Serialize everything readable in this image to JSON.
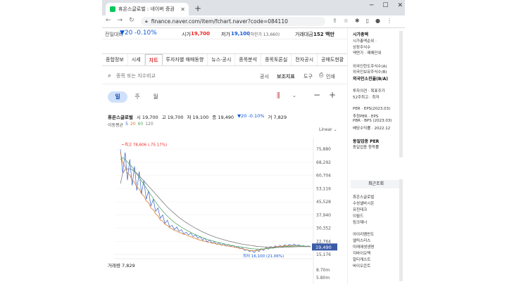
{
  "browser": {
    "tab_title": "휴온스글로벌 : 네이버 증권",
    "new_tab": "+",
    "url": "finance.naver.com/item/fchart.naver?code=084110"
  },
  "stock_strip": {
    "vs_label": "전일대비",
    "vs_value": "▼20",
    "vs_pct": "-0.10%",
    "open_label": "시가",
    "open_value": "19,700",
    "low_label": "저가",
    "low_value": "19,100",
    "low_limit": "(하한가 13,660)",
    "amount_label": "거래대금",
    "amount_value": "152 백만"
  },
  "main_tabs": [
    "종합정보",
    "시세",
    "차트",
    "투자자별 매매동향",
    "뉴스·공시",
    "종목분석",
    "종목토론실",
    "전자공시",
    "공매도현황"
  ],
  "search": {
    "placeholder": "종목 또는 지수비교",
    "buttons": [
      "공시",
      "보조지표",
      "도구",
      "인쇄"
    ]
  },
  "periods": [
    "일",
    "주",
    "월"
  ],
  "chart_header": {
    "name": "휴온스글로벌",
    "open": "시 19,700",
    "high": "고 19,700",
    "low": "저 19,100",
    "close": "종 19,490",
    "change": "▼20 -0.10%",
    "volume": "거 7,829",
    "ma_label": "이동평균",
    "ma_values": [
      "5",
      "20",
      "60",
      "120"
    ],
    "scale": "Linear"
  },
  "chart_annotations": {
    "max_label": "최고 78,606 (-75.17%)",
    "min_label": "최저 16,100 (21.06%)",
    "current_price": "19,490",
    "volume_label": "거래량 7,829",
    "volume_ticks": [
      "8.70m",
      "5.80m"
    ]
  },
  "chart_data": {
    "type": "line",
    "y_ticks": [
      "75,880",
      "68,292",
      "60,704",
      "53,116",
      "45,528",
      "37,940",
      "30,352",
      "22,764",
      "15,176"
    ],
    "ylim": [
      15176,
      80000
    ],
    "series": [
      {
        "values": [
          75800,
          62000,
          74000,
          58000,
          70000,
          55000,
          66000,
          52000,
          63000,
          50000,
          58000,
          47000,
          52000,
          43000,
          47000,
          40000,
          42000,
          36000,
          38000,
          33000,
          35000,
          31000,
          32000,
          29500,
          31000,
          28500,
          29500,
          27000,
          28000,
          26500,
          27500,
          25500,
          26500,
          24500,
          25500,
          23500,
          24500,
          22500,
          23500,
          21800,
          22500,
          21000,
          22000,
          20500,
          21500,
          20000,
          21000,
          19800,
          20500,
          19200,
          19800,
          18500,
          19000,
          17500,
          18000,
          16800,
          17500,
          16200,
          17800,
          16800,
          18500,
          17500,
          19200,
          18200,
          19800,
          18800,
          20200,
          19200,
          20500,
          19500,
          20800,
          19800,
          21000,
          20200,
          21200,
          20300,
          20800,
          19900,
          20300,
          19600,
          20100,
          19490
        ]
      },
      {
        "values": [
          74000,
          68000,
          66000,
          62000,
          61000,
          58000,
          57000,
          54000,
          53000,
          50000,
          49000,
          46000,
          45000,
          42000,
          41000,
          38500,
          37500,
          35000,
          34500,
          32500,
          32000,
          30500,
          30000,
          29000,
          28800,
          27800,
          27500,
          26800,
          26500,
          25800,
          25500,
          24800,
          24500,
          23800,
          23500,
          23000,
          22800,
          22300,
          22100,
          21800,
          21500,
          21200,
          21000,
          20700,
          20500,
          20200,
          20000,
          19800,
          19600,
          19300,
          19000,
          18700,
          18400,
          18000,
          17800,
          17500,
          17400,
          17300,
          17500,
          17700,
          18000,
          18300,
          18600,
          18900,
          19200,
          19400,
          19600,
          19800,
          19900,
          20000,
          20100,
          20200,
          20300,
          20300,
          20300,
          20200,
          20100,
          20000,
          19900,
          19800,
          19700,
          19700
        ]
      },
      {
        "values": [
          70000,
          71000,
          70000,
          68500,
          67000,
          65500,
          63500,
          61500,
          59500,
          57500,
          55500,
          53500,
          51500,
          49500,
          47500,
          45500,
          43500,
          41800,
          40200,
          38700,
          37300,
          36000,
          34800,
          33700,
          32700,
          31800,
          30900,
          30100,
          29300,
          28600,
          27900,
          27200,
          26600,
          26000,
          25400,
          24900,
          24400,
          23900,
          23500,
          23100,
          22700,
          22300,
          22000,
          21700,
          21400,
          21100,
          20800,
          20500,
          20300,
          20000,
          19800,
          19500,
          19300,
          19100,
          18900,
          18700,
          18500,
          18400,
          18300,
          18300,
          18300,
          18400,
          18500,
          18600,
          18800,
          18900,
          19100,
          19300,
          19400,
          19600,
          19700,
          19800,
          19900,
          20000,
          20000,
          20100,
          20100,
          20100,
          20000,
          20000,
          19900,
          19900
        ]
      },
      {
        "values": [
          56000,
          62000,
          64000,
          64500,
          64500,
          64000,
          63000,
          62000,
          60500,
          59000,
          57500,
          56000,
          54500,
          53000,
          51500,
          50000,
          48500,
          47000,
          45500,
          44000,
          42500,
          41200,
          40000,
          38800,
          37600,
          36500,
          35500,
          34500,
          33600,
          32700,
          31900,
          31100,
          30300,
          29600,
          28900,
          28200,
          27600,
          27000,
          26400,
          25900,
          25400,
          24900,
          24500,
          24100,
          23700,
          23300,
          22900,
          22600,
          22300,
          22000,
          21700,
          21400,
          21100,
          20900,
          20700,
          20500,
          20300,
          20100,
          19900,
          19800,
          19700,
          19600,
          19500,
          19400,
          19400,
          19300,
          19300,
          19300,
          19300,
          19300,
          19400,
          19400,
          19500,
          19500,
          19600,
          19600,
          19700,
          19700,
          19700,
          19700,
          19800,
          19800
        ]
      }
    ],
    "series_colors": [
      "#3a63c9",
      "#d97a2a",
      "#57a86b",
      "#7d7d7d"
    ]
  },
  "sidebar": {
    "items_top": [
      "시가총액",
      "시가총액순위 ·",
      "상장주식수",
      "액면가 · 매매단위"
    ],
    "items_mid": [
      "외국인한도주식수(A)",
      "외국인보유주식수(B)",
      "외국인소진율(B/A)"
    ],
    "items_inv": [
      "투자의견 · 목표주가",
      "52주최고 · 최저"
    ],
    "items_per": [
      "PER · EPS(2023.03)",
      "추정PER · EPS",
      "PBR · BPS (2023.03)",
      "배당수익률 · 2022.12"
    ],
    "items_sector": [
      "동일업종 PER",
      "동일업종 등락률"
    ],
    "recent_title": "최근조회",
    "recent": [
      "휴온스글로벌",
      "수성샐바시온",
      "유진테크",
      "이월드",
      "링크제너"
    ],
    "recent2": [
      "아이리멤반도",
      "엘릭스리스",
      "미래에셋생명",
      "지바이오텍",
      "알티캐스트",
      "바이오콘트"
    ]
  },
  "colors": {
    "naver_green": "#03c75a",
    "up_red": "#e22222",
    "down_blue": "#1259d9",
    "price_tag": "#3a5ba8"
  }
}
